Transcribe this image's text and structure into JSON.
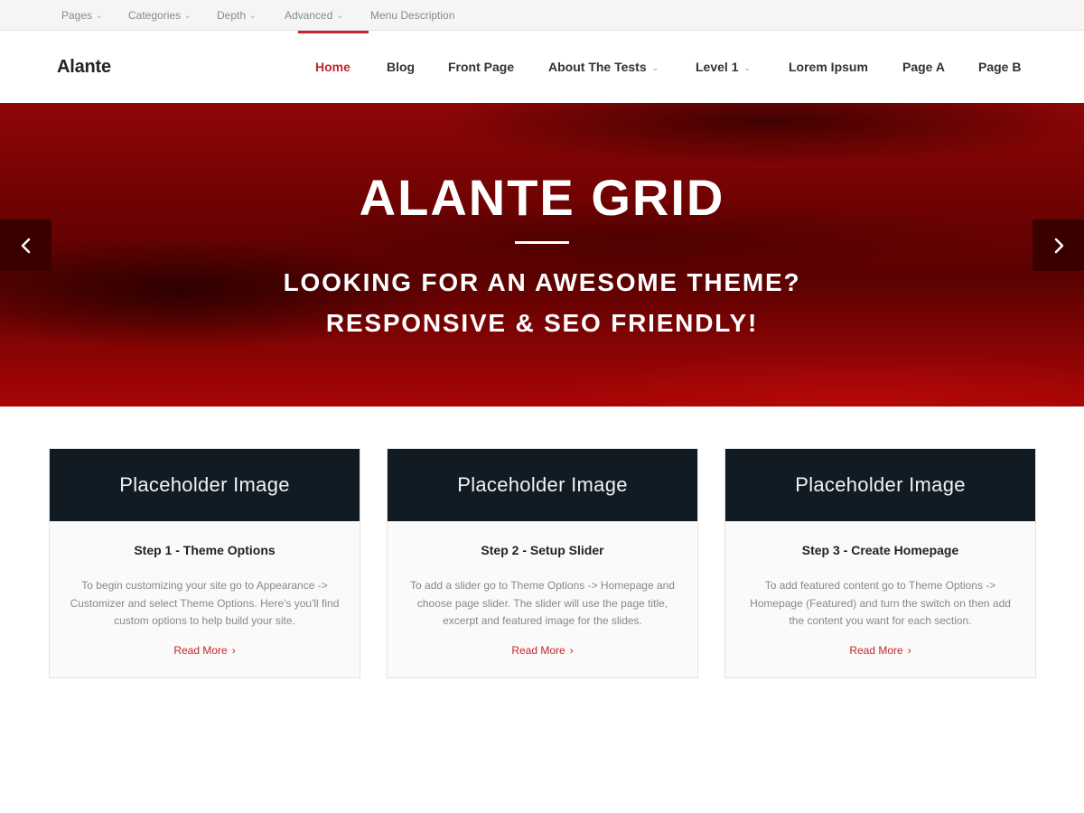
{
  "topbar": {
    "items": [
      {
        "label": "Pages",
        "has_dropdown": true
      },
      {
        "label": "Categories",
        "has_dropdown": true
      },
      {
        "label": "Depth",
        "has_dropdown": true
      },
      {
        "label": "Advanced",
        "has_dropdown": true
      },
      {
        "label": "Menu Description",
        "has_dropdown": false
      }
    ]
  },
  "header": {
    "logo": "Alante",
    "nav": [
      {
        "label": "Home",
        "active": true
      },
      {
        "label": "Blog"
      },
      {
        "label": "Front Page"
      },
      {
        "label": "About The Tests",
        "has_dropdown": true
      },
      {
        "label": "Level 1",
        "has_dropdown": true
      },
      {
        "label": "Lorem Ipsum"
      },
      {
        "label": "Page A"
      },
      {
        "label": "Page B"
      }
    ]
  },
  "hero": {
    "title": "ALANTE GRID",
    "line1": "LOOKING FOR AN AWESOME THEME?",
    "line2": "RESPONSIVE & SEO FRIENDLY!",
    "prev_icon": "chevron-left-icon",
    "next_icon": "chevron-right-icon"
  },
  "cards": [
    {
      "image_label": "Placeholder Image",
      "title": "Step 1 - Theme Options",
      "text": "To begin customizing your site go to Appearance -> Customizer and select Theme Options. Here's you'll find custom options to help build your site.",
      "link": "Read More"
    },
    {
      "image_label": "Placeholder Image",
      "title": "Step 2 - Setup Slider",
      "text": "To add a slider go to Theme Options -> Homepage and choose page slider. The slider will use the page title, excerpt and featured image for the slides.",
      "link": "Read More"
    },
    {
      "image_label": "Placeholder Image",
      "title": "Step 3 - Create Homepage",
      "text": "To add featured content go to Theme Options -> Homepage (Featured) and turn the switch on then add the content you want for each section.",
      "link": "Read More"
    }
  ],
  "colors": {
    "accent": "#c1272d",
    "card_image_bg": "#111b24",
    "hero_base": "#6e0202"
  }
}
